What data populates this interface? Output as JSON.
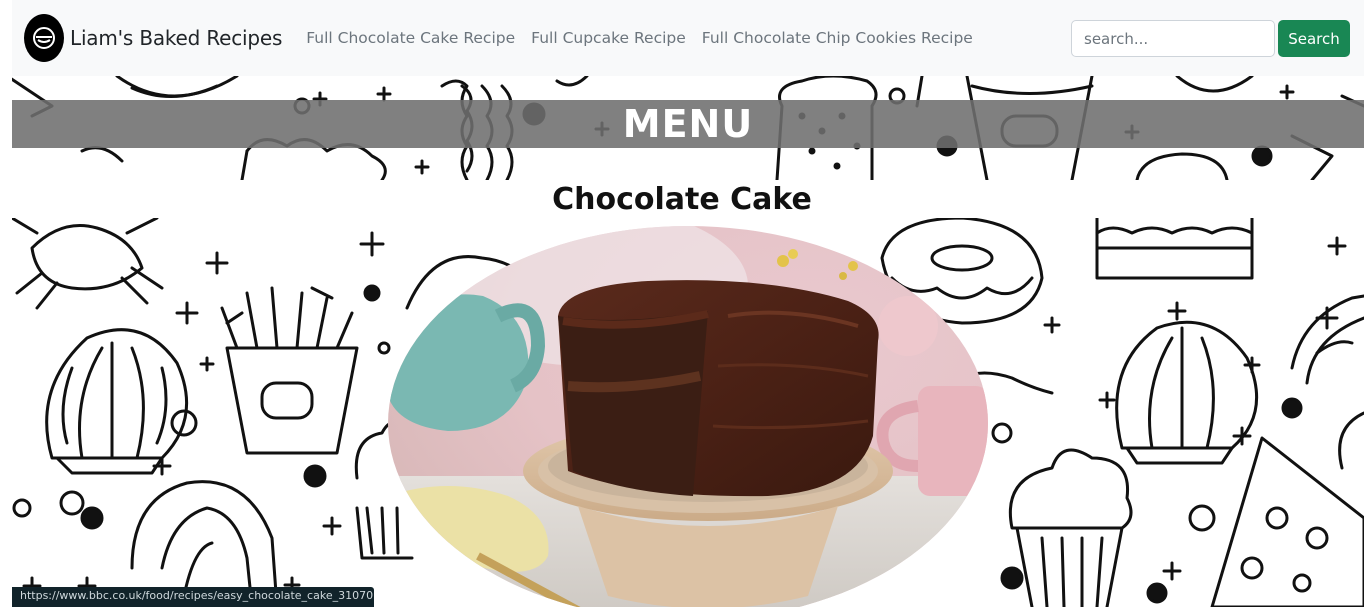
{
  "navbar": {
    "brand": "Liam's Baked Recipes",
    "links": [
      "Full Chocolate Cake Recipe",
      "Full Cupcake Recipe",
      "Full Chocolate Chip Cookies Recipe"
    ],
    "search": {
      "placeholder": "search...",
      "value": "",
      "button_label": "Search"
    }
  },
  "banner": {
    "title": "MENU"
  },
  "section": {
    "title": "Chocolate Cake"
  },
  "status_bar": {
    "url": "https://www.bbc.co.uk/food/recipes/easy_chocolate_cake_31070"
  },
  "colors": {
    "navbar_bg": "#f8f9fa",
    "search_button": "#198754",
    "menu_bar": "#6e6e6e"
  }
}
